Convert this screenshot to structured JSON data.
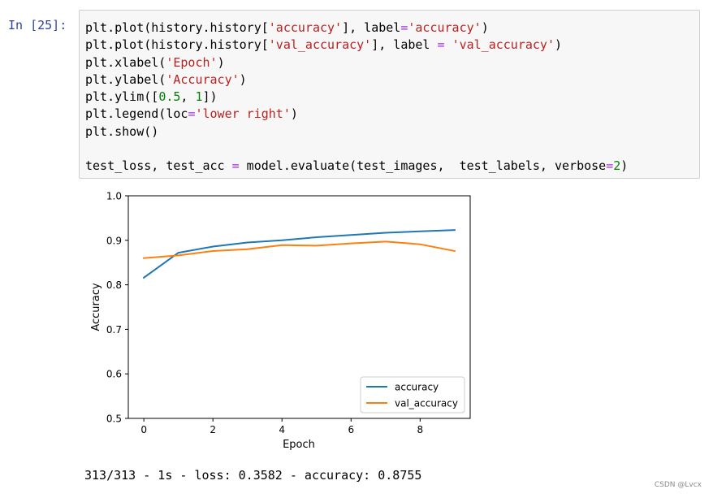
{
  "cell": {
    "prompt": "In  [25]:",
    "code_lines": [
      "plt.plot(history.history['accuracy'], label='accuracy')",
      "plt.plot(history.history['val_accuracy'], label = 'val_accuracy')",
      "plt.xlabel('Epoch')",
      "plt.ylabel('Accuracy')",
      "plt.ylim([0.5, 1])",
      "plt.legend(loc='lower right')",
      "plt.show()",
      "",
      "test_loss, test_acc = model.evaluate(test_images,  test_labels, verbose=2)"
    ]
  },
  "chart_data": {
    "type": "line",
    "xlabel": "Epoch",
    "ylabel": "Accuracy",
    "xlim": [
      -0.45,
      9.45
    ],
    "ylim": [
      0.5,
      1.0
    ],
    "x": [
      0,
      1,
      2,
      3,
      4,
      5,
      6,
      7,
      8,
      9
    ],
    "xticks": [
      "0",
      "2",
      "4",
      "6",
      "8"
    ],
    "xtick_values": [
      0,
      2,
      4,
      6,
      8
    ],
    "yticks": [
      "0.5",
      "0.6",
      "0.7",
      "0.8",
      "0.9",
      "1.0"
    ],
    "ytick_values": [
      0.5,
      0.6,
      0.7,
      0.8,
      0.9,
      1.0
    ],
    "grid": false,
    "legend_loc": "lower right",
    "series": [
      {
        "name": "accuracy",
        "color": "#1f77b4",
        "values": [
          0.816,
          0.872,
          0.886,
          0.895,
          0.9,
          0.907,
          0.912,
          0.917,
          0.92,
          0.923
        ]
      },
      {
        "name": "val_accuracy",
        "color": "#ff7f0e",
        "values": [
          0.86,
          0.866,
          0.876,
          0.88,
          0.889,
          0.888,
          0.893,
          0.897,
          0.891,
          0.876
        ]
      }
    ]
  },
  "output": {
    "text": "313/313 - 1s - loss: 0.3582 - accuracy: 0.8755"
  },
  "watermark": "CSDN @Lvcx"
}
